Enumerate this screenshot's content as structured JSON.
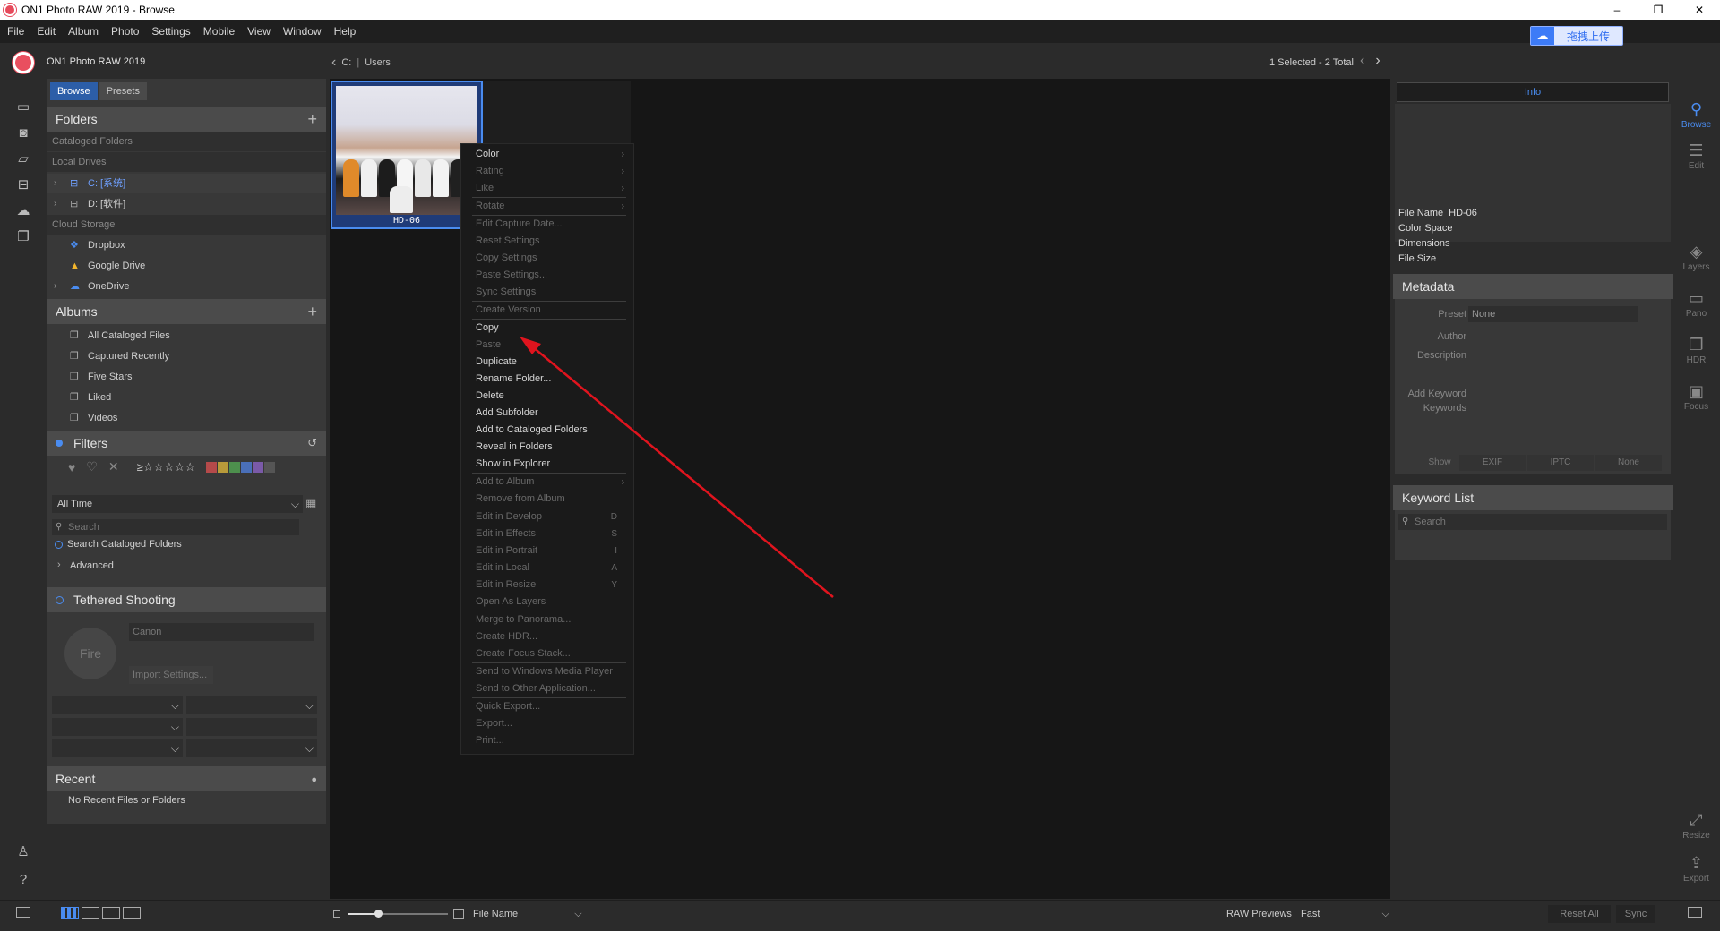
{
  "window": {
    "title": "ON1 Photo RAW 2019 - Browse",
    "controls": [
      "–",
      "❐",
      "✕"
    ]
  },
  "menubar": [
    "File",
    "Edit",
    "Album",
    "Photo",
    "Settings",
    "Mobile",
    "View",
    "Window",
    "Help"
  ],
  "upload_button": "拖拽上传",
  "toolbar": {
    "app_name": "ON1 Photo RAW 2019",
    "breadcrumb_drive": "C:",
    "breadcrumb_folder": "Users",
    "selection": "1 Selected - 2 Total"
  },
  "left_panel": {
    "tabs": [
      "Browse",
      "Presets"
    ],
    "folders": {
      "title": "Folders",
      "cataloged_label": "Cataloged Folders",
      "local_label": "Local Drives",
      "drives": [
        "C: [系统]",
        "D: [软件]"
      ],
      "cloud_label": "Cloud Storage",
      "cloud": [
        "Dropbox",
        "Google Drive",
        "OneDrive"
      ]
    },
    "albums": {
      "title": "Albums",
      "items": [
        "All Cataloged Files",
        "Captured Recently",
        "Five Stars",
        "Liked",
        "Videos"
      ]
    },
    "filters": {
      "title": "Filters",
      "rating_prefix": "≥☆☆☆☆☆",
      "time": "All Time",
      "search_placeholder": "Search",
      "search_cataloged": "Search Cataloged Folders",
      "advanced": "Advanced"
    },
    "tethered": {
      "title": "Tethered Shooting",
      "fire": "Fire",
      "camera": "Canon",
      "import": "Import Settings..."
    },
    "recent": {
      "title": "Recent",
      "empty": "No Recent Files or Folders"
    }
  },
  "thumbnail": {
    "label": "HD-06"
  },
  "context_menu": [
    {
      "label": "Color",
      "sub": true,
      "disabled": false
    },
    {
      "label": "Rating",
      "sub": true,
      "disabled": true
    },
    {
      "label": "Like",
      "sub": true,
      "disabled": true
    },
    {
      "sep": true
    },
    {
      "label": "Rotate",
      "sub": true,
      "disabled": true
    },
    {
      "sep": true
    },
    {
      "label": "Edit Capture Date...",
      "disabled": true
    },
    {
      "label": "Reset Settings",
      "disabled": true
    },
    {
      "label": "Copy Settings",
      "disabled": true
    },
    {
      "label": "Paste Settings...",
      "disabled": true
    },
    {
      "label": "Sync Settings",
      "disabled": true
    },
    {
      "sep": true
    },
    {
      "label": "Create Version",
      "disabled": true
    },
    {
      "sep": true
    },
    {
      "label": "Copy",
      "disabled": false
    },
    {
      "label": "Paste",
      "disabled": true
    },
    {
      "label": "Duplicate",
      "disabled": false
    },
    {
      "label": "Rename Folder...",
      "disabled": false
    },
    {
      "label": "Delete",
      "disabled": false
    },
    {
      "label": "Add Subfolder",
      "disabled": false
    },
    {
      "label": "Add to Cataloged Folders",
      "disabled": false
    },
    {
      "label": "Reveal in Folders",
      "disabled": false
    },
    {
      "label": "Show in Explorer",
      "disabled": false
    },
    {
      "sep": true
    },
    {
      "label": "Add to Album",
      "sub": true,
      "disabled": true
    },
    {
      "label": "Remove from Album",
      "disabled": true
    },
    {
      "sep": true
    },
    {
      "label": "Edit in Develop",
      "key": "D",
      "disabled": true
    },
    {
      "label": "Edit in Effects",
      "key": "S",
      "disabled": true
    },
    {
      "label": "Edit in Portrait",
      "key": "I",
      "disabled": true
    },
    {
      "label": "Edit in Local",
      "key": "A",
      "disabled": true
    },
    {
      "label": "Edit in Resize",
      "key": "Y",
      "disabled": true
    },
    {
      "label": "Open As Layers",
      "disabled": true
    },
    {
      "sep": true
    },
    {
      "label": "Merge to Panorama...",
      "disabled": true
    },
    {
      "label": "Create HDR...",
      "disabled": true
    },
    {
      "label": "Create Focus Stack...",
      "disabled": true
    },
    {
      "sep": true
    },
    {
      "label": "Send to Windows Media Player",
      "disabled": true
    },
    {
      "label": "Send to Other Application...",
      "disabled": true
    },
    {
      "sep": true
    },
    {
      "label": "Quick Export...",
      "disabled": true
    },
    {
      "label": "Export...",
      "disabled": true
    },
    {
      "label": "Print...",
      "disabled": true
    }
  ],
  "right_panel": {
    "info_tab": "Info",
    "info": {
      "file_name_label": "File Name",
      "file_name": "HD-06",
      "color_space_label": "Color Space",
      "dimensions_label": "Dimensions",
      "file_size_label": "File Size"
    },
    "metadata": {
      "title": "Metadata",
      "preset_label": "Preset",
      "preset_value": "None",
      "author_label": "Author",
      "description_label": "Description",
      "add_keyword_label": "Add Keyword",
      "keywords_label": "Keywords",
      "show_label": "Show",
      "show_options": [
        "EXIF",
        "IPTC",
        "None"
      ]
    },
    "keyword_list": {
      "title": "Keyword List",
      "search_placeholder": "Search"
    }
  },
  "right_rail": [
    "Browse",
    "Edit",
    "Layers",
    "Pano",
    "HDR",
    "Focus",
    "Resize",
    "Export"
  ],
  "bottombar": {
    "sort_label": "File Name",
    "raw_previews_label": "RAW Previews",
    "raw_previews_value": "Fast",
    "reset_all": "Reset All",
    "sync": "Sync"
  },
  "zoom_slider": 0.3,
  "colors": {
    "accent": "#4a8cf0",
    "arrow": "#e0141e",
    "selected_drive": "#6fa0ff"
  }
}
